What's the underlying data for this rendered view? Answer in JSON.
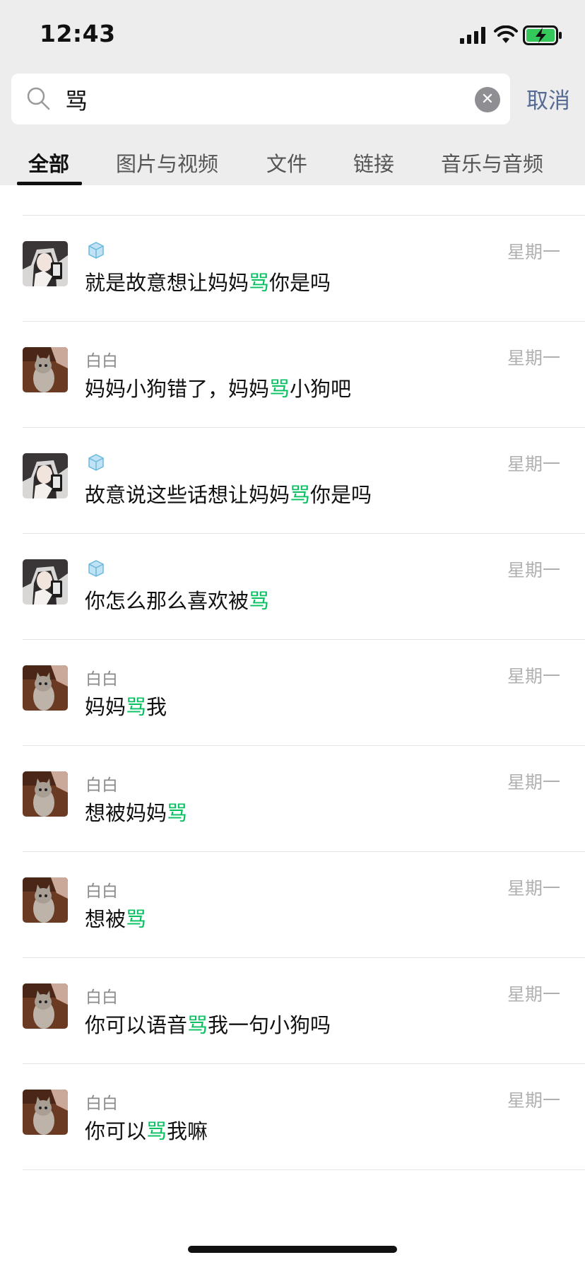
{
  "status_bar": {
    "time": "12:43"
  },
  "search": {
    "query": "骂",
    "cancel_label": "取消"
  },
  "tabs": [
    {
      "label": "全部",
      "active": true
    },
    {
      "label": "图片与视频",
      "active": false
    },
    {
      "label": "文件",
      "active": false
    },
    {
      "label": "链接",
      "active": false
    },
    {
      "label": "音乐与音频",
      "active": false
    }
  ],
  "highlight_color": "#07c160",
  "results": [
    {
      "avatar": "anime-girl-avatar",
      "name": "",
      "name_icon": "ice-cube-icon",
      "date": "星期一",
      "before": "就是故意想让妈妈",
      "match": "骂",
      "after": "你是吗"
    },
    {
      "avatar": "cat-avatar",
      "name": "白白",
      "name_icon": "",
      "date": "星期一",
      "before": "妈妈小狗错了，妈妈",
      "match": "骂",
      "after": "小狗吧"
    },
    {
      "avatar": "anime-girl-avatar",
      "name": "",
      "name_icon": "ice-cube-icon",
      "date": "星期一",
      "before": "故意说这些话想让妈妈",
      "match": "骂",
      "after": "你是吗"
    },
    {
      "avatar": "anime-girl-avatar",
      "name": "",
      "name_icon": "ice-cube-icon",
      "date": "星期一",
      "before": "你怎么那么喜欢被",
      "match": "骂",
      "after": ""
    },
    {
      "avatar": "cat-avatar",
      "name": "白白",
      "name_icon": "",
      "date": "星期一",
      "before": "妈妈",
      "match": "骂",
      "after": "我"
    },
    {
      "avatar": "cat-avatar",
      "name": "白白",
      "name_icon": "",
      "date": "星期一",
      "before": "想被妈妈",
      "match": "骂",
      "after": ""
    },
    {
      "avatar": "cat-avatar",
      "name": "白白",
      "name_icon": "",
      "date": "星期一",
      "before": "想被",
      "match": "骂",
      "after": ""
    },
    {
      "avatar": "cat-avatar",
      "name": "白白",
      "name_icon": "",
      "date": "星期一",
      "before": "你可以语音",
      "match": "骂",
      "after": "我一句小狗吗"
    },
    {
      "avatar": "cat-avatar",
      "name": "白白",
      "name_icon": "",
      "date": "星期一",
      "before": "你可以",
      "match": "骂",
      "after": "我嘛"
    }
  ]
}
